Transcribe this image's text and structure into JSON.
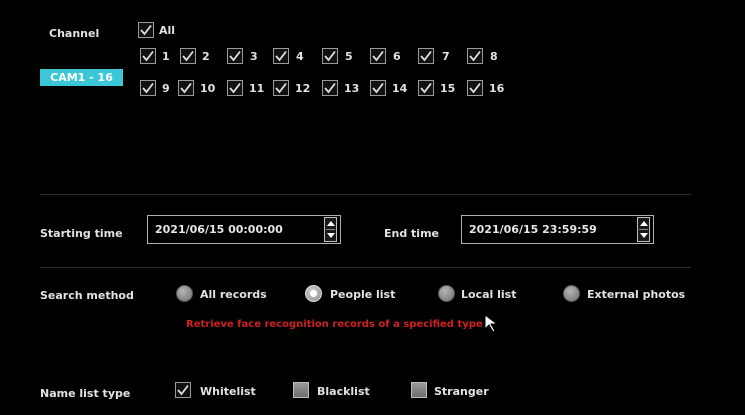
{
  "channel": {
    "label": "Channel",
    "all_label": "All",
    "cam_button": "CAM1 - 16",
    "checkboxes": [
      "1",
      "2",
      "3",
      "4",
      "5",
      "6",
      "7",
      "8",
      "9",
      "10",
      "11",
      "12",
      "13",
      "14",
      "15",
      "16"
    ]
  },
  "time": {
    "start_label": "Starting time",
    "start_value": "2021/06/15 00:00:00",
    "end_label": "End time",
    "end_value": "2021/06/15 23:59:59"
  },
  "search": {
    "label": "Search method",
    "options": [
      "All records",
      "People list",
      "Local list",
      "External photos"
    ],
    "selected": "People list",
    "hint": "Retrieve face recognition records of a specified type"
  },
  "name_list": {
    "label": "Name list type",
    "whitelist": "Whitelist",
    "blacklist": "Blacklist",
    "stranger": "Stranger"
  },
  "colors": {
    "accent": "#3cc7d8",
    "hint_red": "#d12020",
    "background": "#000000"
  }
}
